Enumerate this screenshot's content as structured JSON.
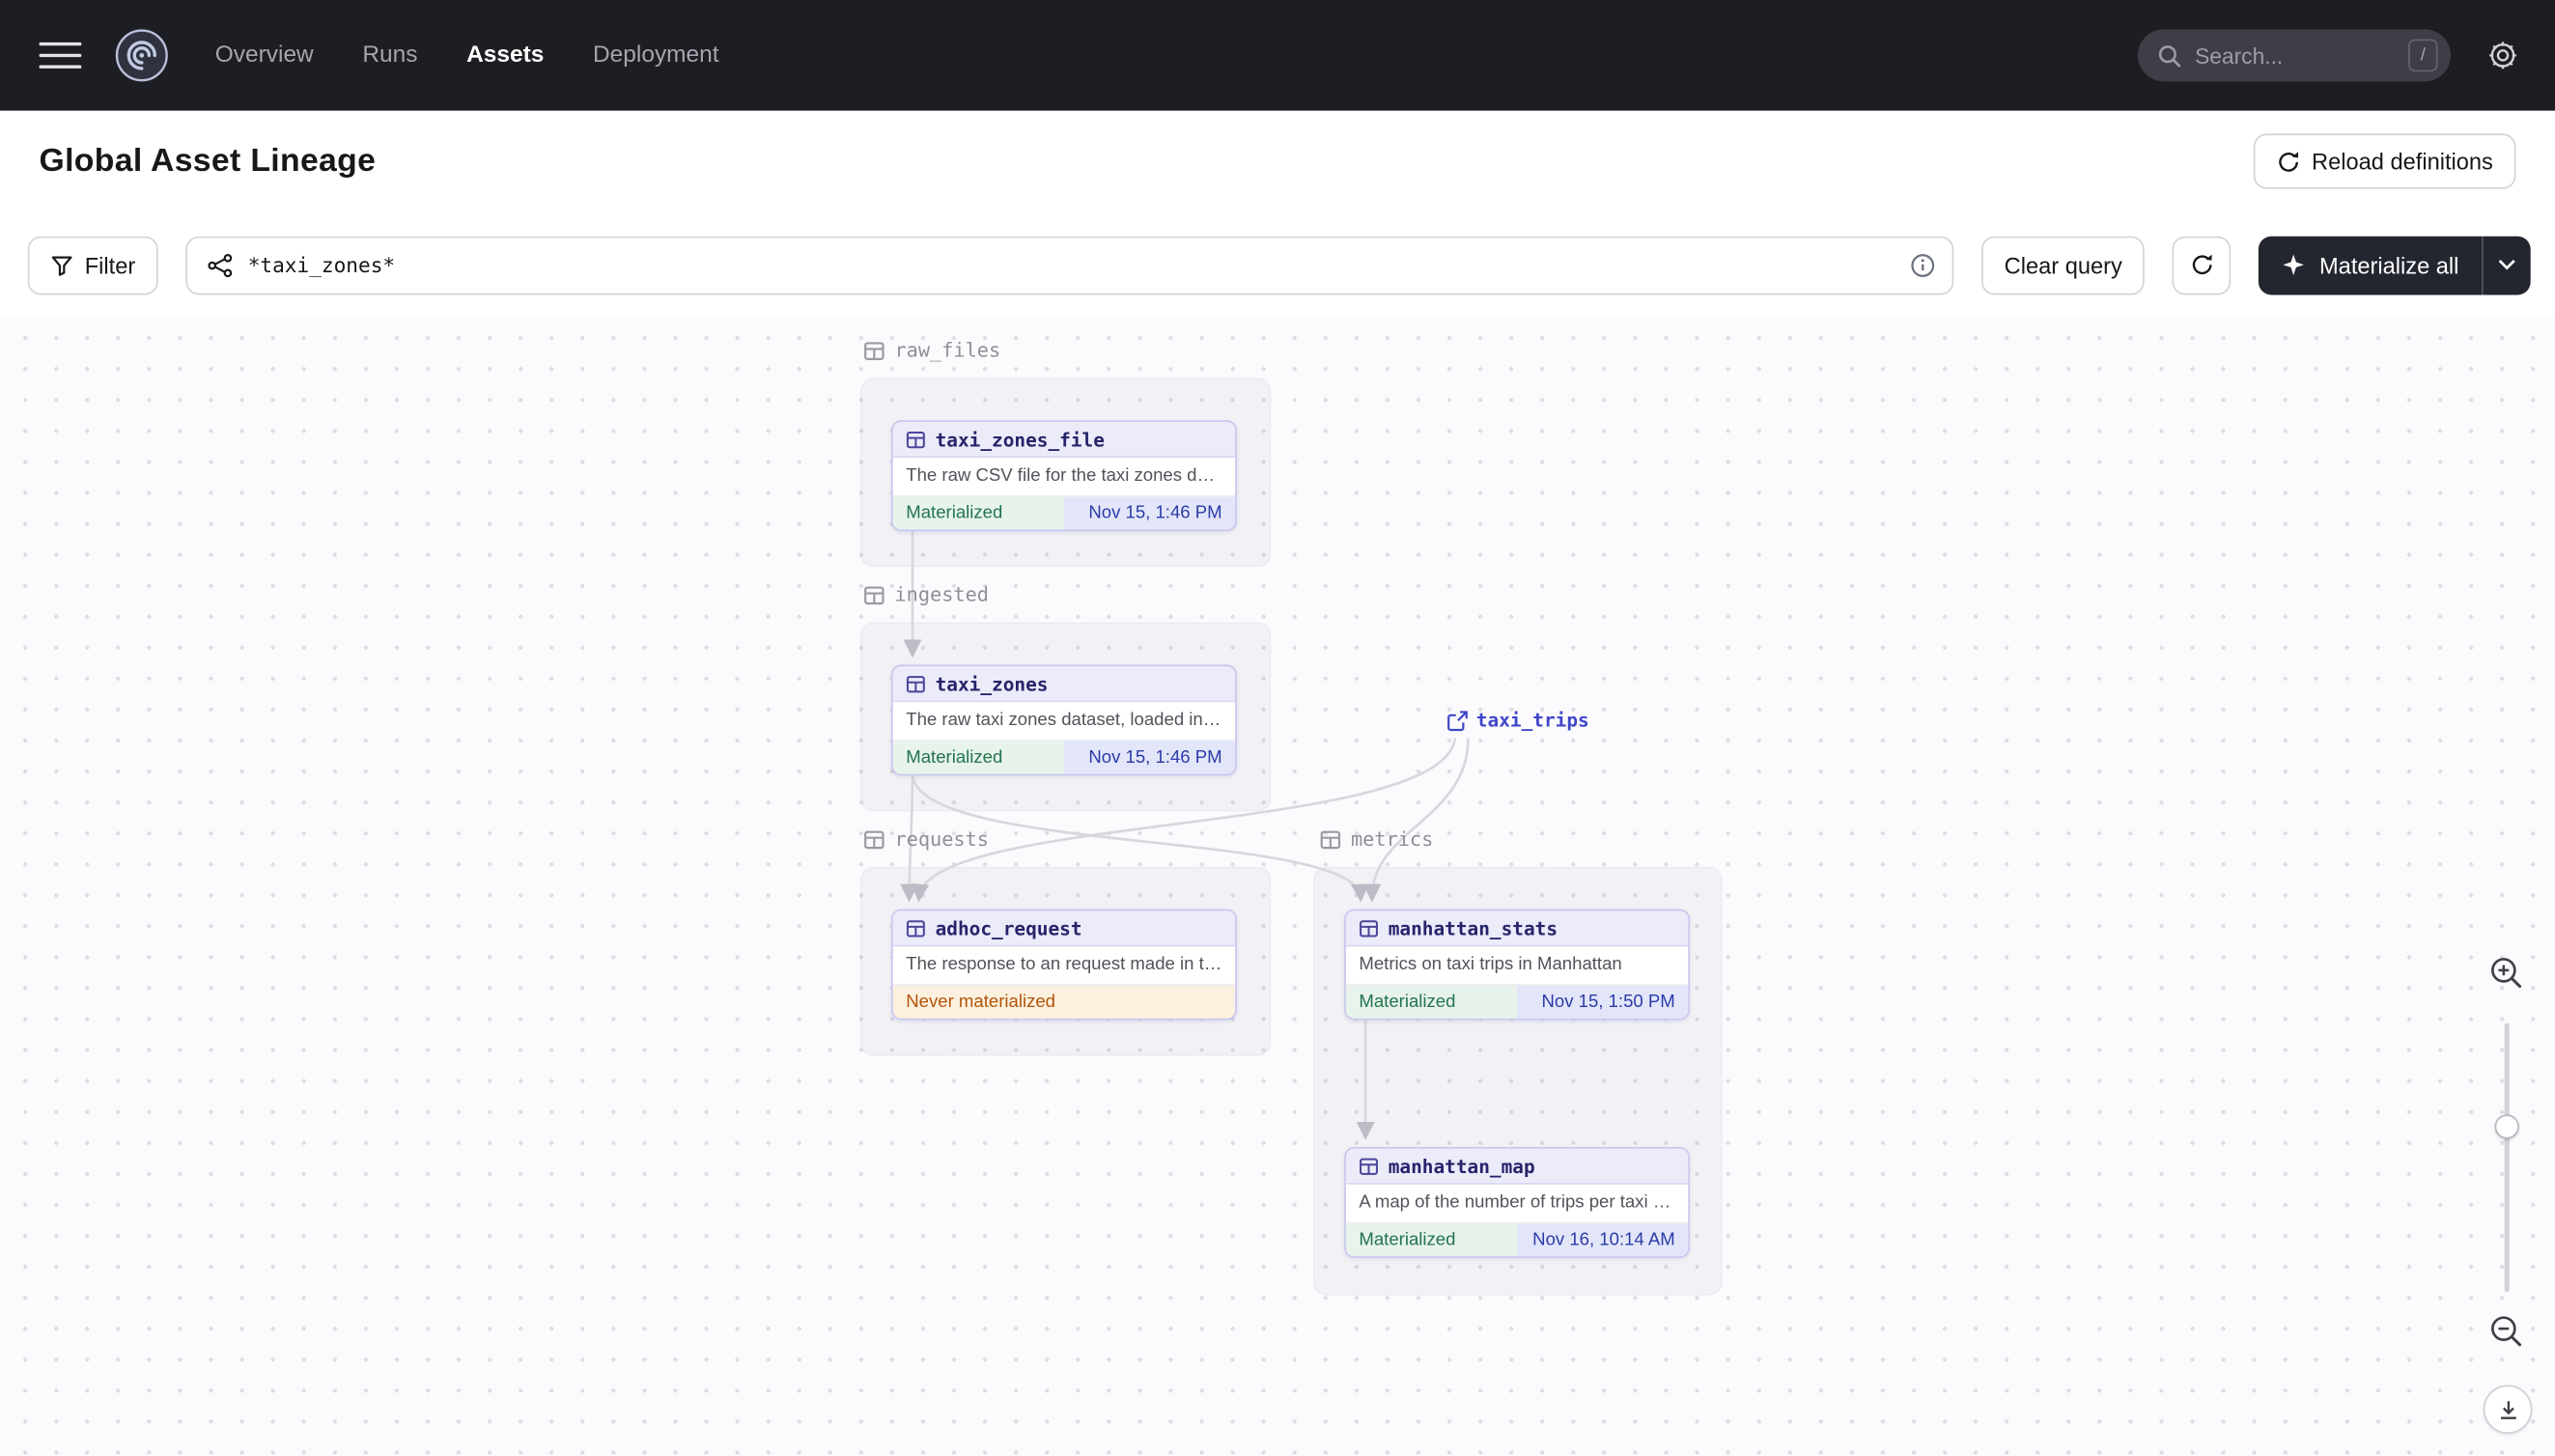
{
  "topbar": {
    "nav_items": [
      {
        "label": "Overview",
        "active": false
      },
      {
        "label": "Runs",
        "active": false
      },
      {
        "label": "Assets",
        "active": true
      },
      {
        "label": "Deployment",
        "active": false
      }
    ],
    "search": {
      "placeholder": "Search...",
      "shortcut": "/"
    }
  },
  "header": {
    "title": "Global Asset Lineage",
    "reload_button_label": "Reload definitions"
  },
  "toolbar": {
    "filter_label": "Filter",
    "query_value": "*taxi_zones*",
    "clear_query_label": "Clear query",
    "materialize_label": "Materialize all"
  },
  "lineage": {
    "groups": [
      {
        "name": "raw_files"
      },
      {
        "name": "ingested"
      },
      {
        "name": "requests"
      },
      {
        "name": "metrics"
      }
    ],
    "nodes": [
      {
        "name": "taxi_zones_file",
        "group": "raw_files",
        "description": "The raw CSV file for the taxi zones dat...",
        "status_label": "Materialized",
        "timestamp": "Nov 15, 1:46 PM"
      },
      {
        "name": "taxi_zones",
        "group": "ingested",
        "description": "The raw taxi zones dataset, loaded int...",
        "status_label": "Materialized",
        "timestamp": "Nov 15, 1:46 PM"
      },
      {
        "name": "adhoc_request",
        "group": "requests",
        "description": "The response to an request made in th...",
        "status_label": "Never materialized"
      },
      {
        "name": "manhattan_stats",
        "group": "metrics",
        "description": "Metrics on taxi trips in Manhattan",
        "status_label": "Materialized",
        "timestamp": "Nov 15, 1:50 PM"
      },
      {
        "name": "manhattan_map",
        "group": "metrics",
        "description": "A map of the number of trips per taxi z...",
        "status_label": "Materialized",
        "timestamp": "Nov 16, 10:14 AM"
      }
    ],
    "external_assets": [
      {
        "name": "taxi_trips"
      }
    ]
  },
  "colors": {
    "topbar_bg": "#1d1e23",
    "materialize_button_bg": "#23252f",
    "node_border": "#c9c5ef",
    "node_header_bg": "#ecebfa",
    "status_materialized_bg": "#e7f3eb",
    "status_materialized_text": "#23744d",
    "timestamp_bg": "#e3e6f9",
    "timestamp_text": "#2a3ba8",
    "never_materialized_bg": "#fbf1de",
    "never_materialized_text": "#b45309",
    "external_asset_text": "#3f46c9",
    "edge_stroke": "#d7d7de"
  }
}
